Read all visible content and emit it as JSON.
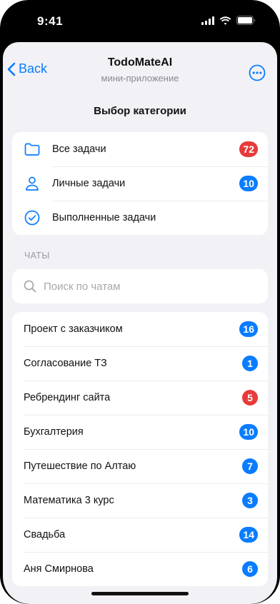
{
  "status_bar": {
    "time": "9:41",
    "icons": [
      "cellular-signal-icon",
      "wifi-icon",
      "battery-icon"
    ]
  },
  "nav": {
    "back_label": "Back",
    "title": "TodoMateAI",
    "subtitle": "мини-приложение",
    "more_icon": "ellipsis-circle-icon"
  },
  "page": {
    "title": "Выбор категории"
  },
  "categories": [
    {
      "icon": "folder-icon",
      "label": "Все задачи",
      "count": "72",
      "badge_color": "red"
    },
    {
      "icon": "person-icon",
      "label": "Личные задачи",
      "count": "10",
      "badge_color": "blue"
    },
    {
      "icon": "checkmark-circle-icon",
      "label": "Выполненные задачи",
      "count": "",
      "badge_color": ""
    }
  ],
  "chats": {
    "header": "ЧАТЫ",
    "search_placeholder": "Поиск по чатам",
    "search_value": "",
    "items": [
      {
        "label": "Проект с заказчиком",
        "count": "16",
        "badge_color": "blue"
      },
      {
        "label": "Согласование ТЗ",
        "count": "1",
        "badge_color": "blue"
      },
      {
        "label": "Ребрендинг сайта",
        "count": "5",
        "badge_color": "red"
      },
      {
        "label": "Бухгалтерия",
        "count": "10",
        "badge_color": "blue"
      },
      {
        "label": "Путешествие по Алтаю",
        "count": "7",
        "badge_color": "blue"
      },
      {
        "label": "Математика 3 курс",
        "count": "3",
        "badge_color": "blue"
      },
      {
        "label": "Свадьба",
        "count": "14",
        "badge_color": "blue"
      },
      {
        "label": "Аня Смирнова",
        "count": "6",
        "badge_color": "blue"
      }
    ]
  },
  "colors": {
    "accent": "#0a7cff",
    "alert": "#e63b3b",
    "background": "#f2f2f6"
  }
}
